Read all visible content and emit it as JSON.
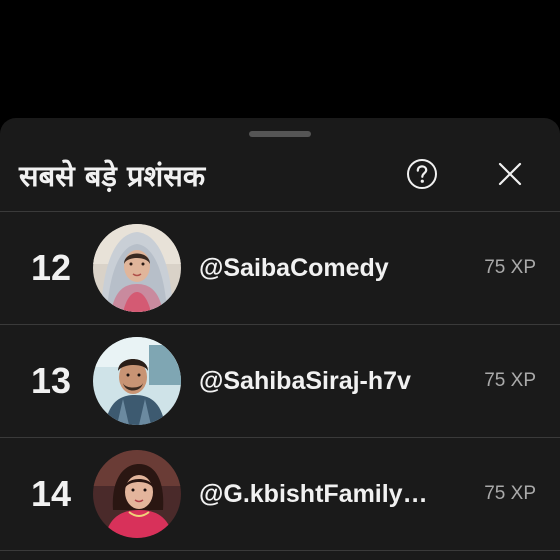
{
  "sheet": {
    "title": "सबसे बड़े प्रशंसक",
    "help_icon": "help-circle-icon",
    "close_icon": "close-icon"
  },
  "fans": [
    {
      "rank": "12",
      "handle": "@SaibaComedy",
      "xp": "75 XP"
    },
    {
      "rank": "13",
      "handle": "@SahibaSiraj-h7v",
      "xp": "75 XP"
    },
    {
      "rank": "14",
      "handle": "@G.kbishtFamily…",
      "xp": "75 XP"
    }
  ],
  "colors": {
    "background": "#000000",
    "sheet": "#1a1a1a",
    "text": "#f1f1f1",
    "muted": "#aaaaaa",
    "divider": "#3a3a3a"
  }
}
